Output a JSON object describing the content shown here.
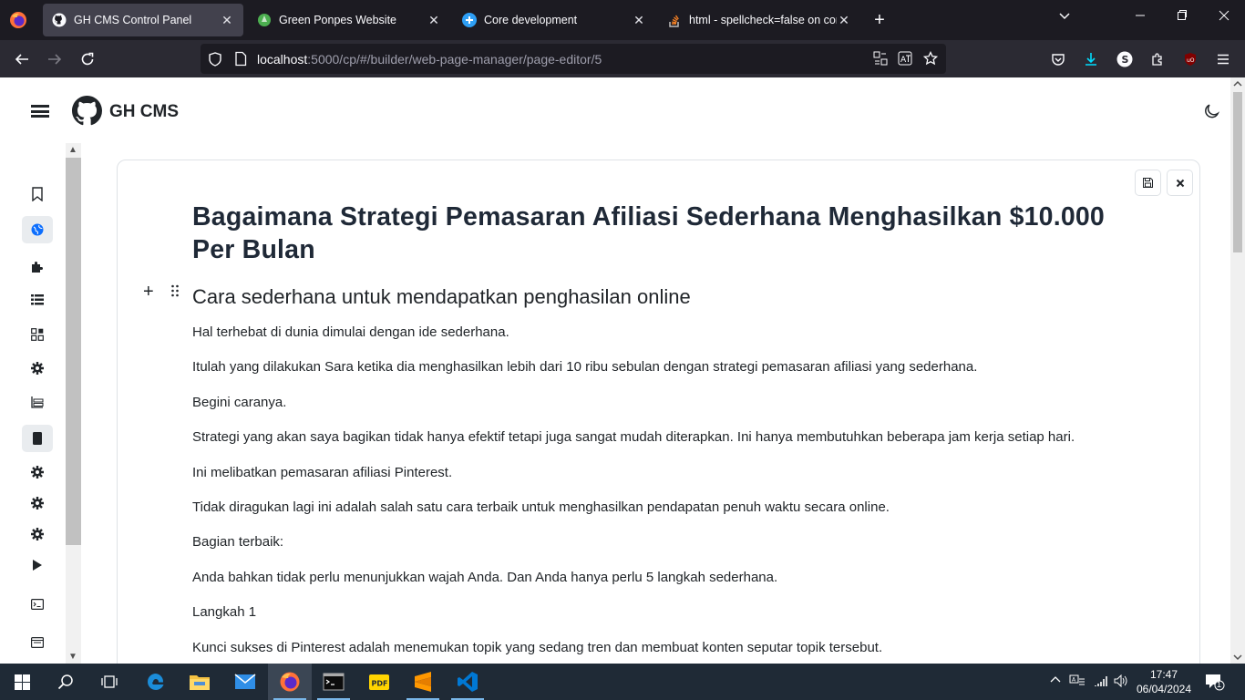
{
  "browser": {
    "tabs": [
      {
        "label": "GH CMS Control Panel",
        "active": true
      },
      {
        "label": "Green Ponpes Website",
        "active": false
      },
      {
        "label": "Core development",
        "active": false
      },
      {
        "label": "html - spellcheck=false on conte",
        "active": false
      }
    ],
    "url_host": "localhost",
    "url_rest": ":5000/cp/#/builder/web-page-manager/page-editor/5"
  },
  "app": {
    "brand": "GH CMS"
  },
  "editor": {
    "title": "Bagaimana Strategi Pemasaran Afiliasi Sederhana Menghasilkan $10.000 Per Bulan",
    "subtitle": "Cara sederhana untuk mendapatkan penghasilan online",
    "paragraphs": [
      "Hal terhebat di dunia dimulai dengan ide sederhana.",
      "Itulah yang dilakukan Sara ketika dia menghasilkan lebih dari 10 ribu sebulan dengan strategi pemasaran afiliasi yang sederhana.",
      "Begini caranya.",
      "Strategi yang akan saya bagikan tidak hanya efektif tetapi juga sangat mudah diterapkan. Ini hanya membutuhkan beberapa jam kerja setiap hari.",
      "Ini melibatkan pemasaran afiliasi Pinterest.",
      "Tidak diragukan lagi ini adalah salah satu cara terbaik untuk menghasilkan pendapatan penuh waktu secara online.",
      "Bagian terbaik:",
      "Anda bahkan tidak perlu menunjukkan wajah Anda. Dan Anda hanya perlu 5 langkah sederhana.",
      "Langkah 1",
      "Kunci sukses di Pinterest adalah menemukan topik yang sedang tren dan membuat konten seputar topik tersebut."
    ]
  },
  "taskbar": {
    "time": "17:47",
    "date": "06/04/2024",
    "notification_count": "1"
  },
  "colors": {
    "browser_tabbar": "#1c1b22",
    "browser_navbar": "#2b2a33",
    "download_accent": "#00ddff",
    "taskbar": "#1f2a36",
    "text": "#212529"
  }
}
